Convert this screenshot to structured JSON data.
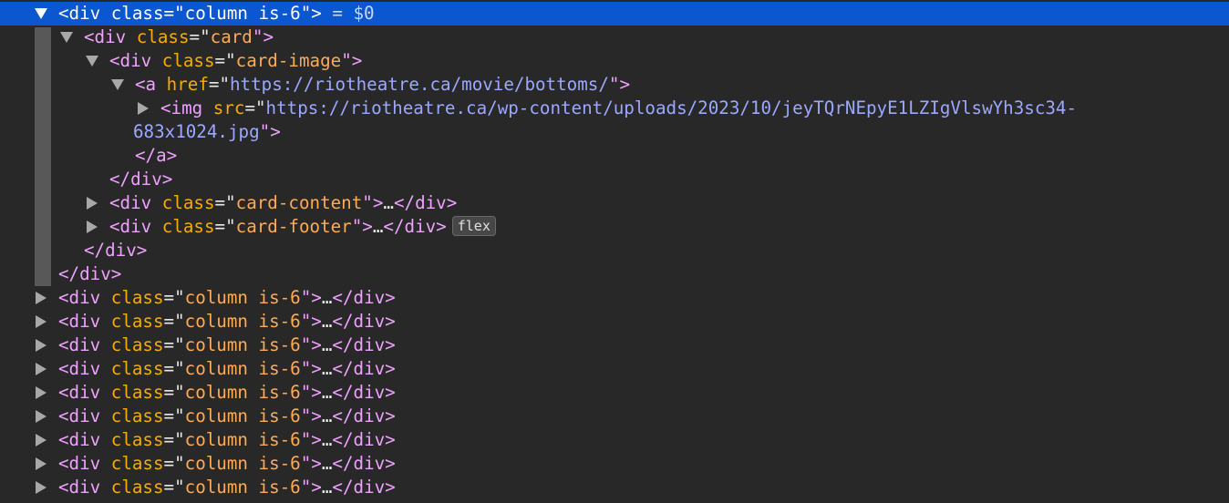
{
  "selected": {
    "open": "<div",
    "attr": "class",
    "eqq": "=\"",
    "value": "column is-6",
    "close": "\">",
    "console_ref": " = $0"
  },
  "card": {
    "open": "<div",
    "attr": "class",
    "value": "card",
    "close": ">"
  },
  "card_image": {
    "open": "<div",
    "attr": "class",
    "value": "card-image",
    "close": ">"
  },
  "anchor": {
    "open": "<a",
    "attr": "href",
    "value": "https://riotheatre.ca/movie/bottoms/",
    "close": ">"
  },
  "img": {
    "open": "<img",
    "attr": "src",
    "value_line1": "https://riotheatre.ca/wp-content/uploads/2023/10/jeyTQrNEpyE1LZIgVlswYh3sc34-",
    "value_line2": "683x1024.jpg",
    "close": ">"
  },
  "anchor_close": "</a>",
  "card_image_close": "</div>",
  "card_content": {
    "open": "<div",
    "attr": "class",
    "value": "card-content",
    "close": ">",
    "ellipsis": "…",
    "end": "</div>"
  },
  "card_footer": {
    "open": "<div",
    "attr": "class",
    "value": "card-footer",
    "close": ">",
    "ellipsis": "…",
    "end": "</div>",
    "badge": "flex"
  },
  "card_close": "</div>",
  "selected_close": "</div>",
  "sibling": {
    "open": "<div",
    "attr": "class",
    "value": "column is-6",
    "close": ">",
    "ellipsis": "…",
    "end": "</div>"
  },
  "colors": {
    "background": "#282828",
    "selection": "#0b57d0",
    "tag": "#f0a0ff",
    "attribute": "#f9ab00",
    "attribute_value": "#ffaa55",
    "url": "#9aa8ff"
  },
  "icons": {
    "expanded": "triangle-down-icon",
    "collapsed": "triangle-right-icon"
  }
}
